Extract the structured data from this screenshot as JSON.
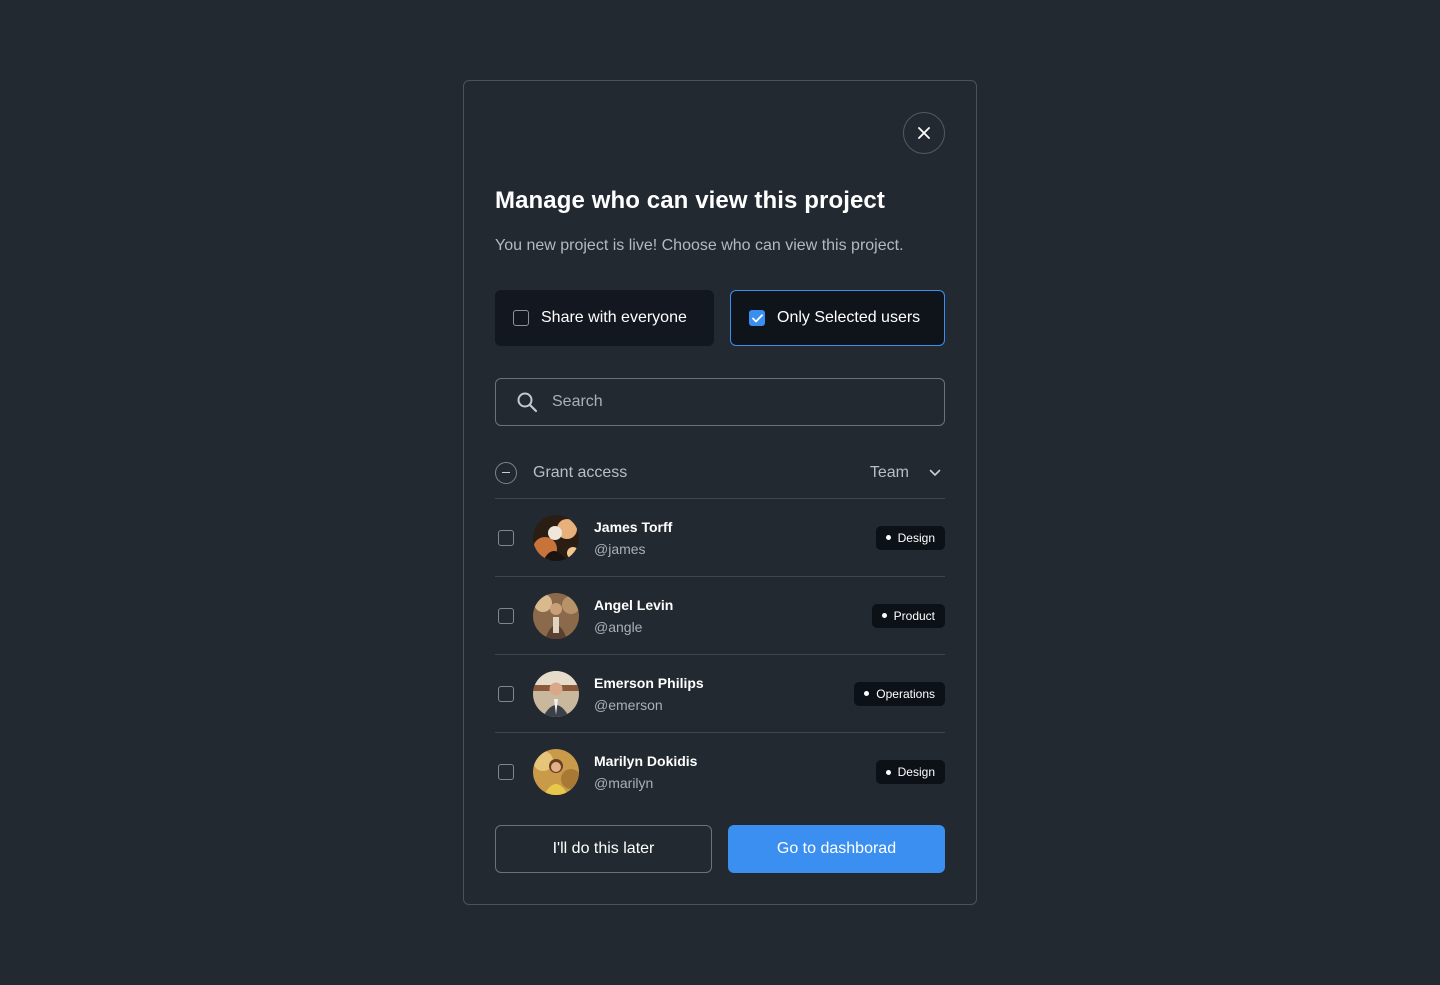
{
  "modal": {
    "title": "Manage who can view this project",
    "subtitle": "You new project is live! Choose who can view this project."
  },
  "share_options": [
    {
      "label": "Share with everyone",
      "checked": false
    },
    {
      "label": "Only Selected users",
      "checked": true
    }
  ],
  "search": {
    "placeholder": "Search",
    "value": ""
  },
  "list_header": {
    "grant_label": "Grant access",
    "team_label": "Team"
  },
  "users": [
    {
      "name": "James Torff",
      "handle": "@james",
      "team": "Design",
      "checked": false
    },
    {
      "name": "Angel Levin",
      "handle": "@angle",
      "team": "Product",
      "checked": false
    },
    {
      "name": "Emerson Philips",
      "handle": "@emerson",
      "team": "Operations",
      "checked": false
    },
    {
      "name": "Marilyn Dokidis",
      "handle": "@marilyn",
      "team": "Design",
      "checked": false
    }
  ],
  "actions": {
    "later_label": "I'll do this later",
    "dashboard_label": "Go to dashborad"
  },
  "colors": {
    "accent": "#3b8ff0",
    "background": "#222931",
    "badge_bg": "#0c1118"
  }
}
